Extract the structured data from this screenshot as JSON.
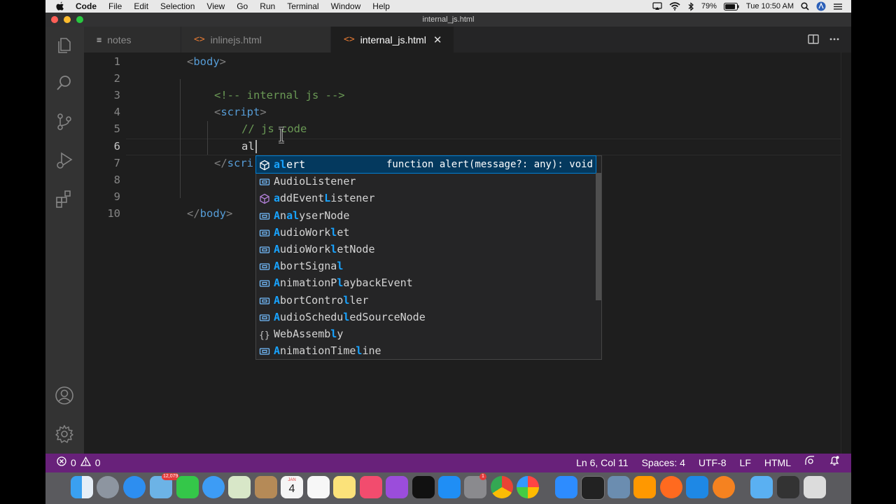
{
  "menubar": {
    "app": "Code",
    "items": [
      "File",
      "Edit",
      "Selection",
      "View",
      "Go",
      "Run",
      "Terminal",
      "Window",
      "Help"
    ],
    "battery": "79%",
    "clock": "Tue 10:50 AM"
  },
  "window": {
    "title": "internal_js.html"
  },
  "tabs": [
    {
      "label": "notes",
      "icon": "notes-icon",
      "active": false
    },
    {
      "label": "inlinejs.html",
      "icon": "html-icon",
      "active": false
    },
    {
      "label": "internal_js.html",
      "icon": "html-icon",
      "active": true
    }
  ],
  "editor": {
    "line_numbers": [
      "1",
      "2",
      "3",
      "4",
      "5",
      "6",
      "7",
      "8",
      "9",
      "10"
    ],
    "lines": {
      "l1": {
        "open": "<",
        "name": "body",
        "close": ">"
      },
      "l3": {
        "comment": "<!-- internal js -->"
      },
      "l4": {
        "open": "<",
        "name": "script",
        "close": ">"
      },
      "l5": {
        "comment": "// js code"
      },
      "l6": {
        "text": "al"
      },
      "l7": {
        "open": "</",
        "name": "scri"
      },
      "l10": {
        "open": "</",
        "name": "body",
        "close": ">"
      }
    },
    "current_line": 6
  },
  "suggest": {
    "selected_detail": "function alert(message?: any): void",
    "items": [
      {
        "parts": [
          "al",
          "ert"
        ],
        "hl": [
          true,
          false
        ],
        "kind": "method"
      },
      {
        "parts": [
          "A",
          "udio",
          "L",
          "istener"
        ],
        "hl": [
          false,
          false,
          false,
          false
        ],
        "kind": "variable"
      },
      {
        "parts": [
          "a",
          "ddEvent",
          "L",
          "istener"
        ],
        "hl": [
          true,
          false,
          true,
          false
        ],
        "kind": "method"
      },
      {
        "parts": [
          "A",
          "n",
          "al",
          "yserNode"
        ],
        "hl": [
          true,
          false,
          true,
          false
        ],
        "kind": "variable"
      },
      {
        "parts": [
          "A",
          "udioWork",
          "l",
          "et"
        ],
        "hl": [
          true,
          false,
          true,
          false
        ],
        "kind": "variable"
      },
      {
        "parts": [
          "A",
          "udioWork",
          "l",
          "etNode"
        ],
        "hl": [
          true,
          false,
          true,
          false
        ],
        "kind": "variable"
      },
      {
        "parts": [
          "A",
          "bortSigna",
          "l",
          ""
        ],
        "hl": [
          true,
          false,
          true,
          false
        ],
        "kind": "variable"
      },
      {
        "parts": [
          "A",
          "nimationP",
          "l",
          "aybackEvent"
        ],
        "hl": [
          true,
          false,
          true,
          false
        ],
        "kind": "variable"
      },
      {
        "parts": [
          "A",
          "bortContro",
          "l",
          "ler"
        ],
        "hl": [
          true,
          false,
          true,
          false
        ],
        "kind": "variable"
      },
      {
        "parts": [
          "A",
          "udioSchedu",
          "l",
          "edSourceNode"
        ],
        "hl": [
          true,
          false,
          true,
          false
        ],
        "kind": "variable"
      },
      {
        "parts": [
          "WebA",
          "ssemb",
          "l",
          "y"
        ],
        "hl": [
          false,
          false,
          true,
          false
        ],
        "kind": "module"
      },
      {
        "parts": [
          "A",
          "nimationTime",
          "l",
          "ine"
        ],
        "hl": [
          true,
          false,
          true,
          false
        ],
        "kind": "variable"
      }
    ]
  },
  "statusbar": {
    "errors": "0",
    "warnings": "0",
    "position": "Ln 6, Col 11",
    "spaces": "Spaces: 4",
    "encoding": "UTF-8",
    "eol": "LF",
    "language": "HTML"
  },
  "dock": {
    "badge_calendar_month": "JAN",
    "badge_calendar_day": "4",
    "badge_photos": "12,079",
    "badge_prefs": "1"
  },
  "colors": {
    "statusbar": "#68217a",
    "accent": "#007fd4",
    "highlight": "#18a3ff"
  }
}
